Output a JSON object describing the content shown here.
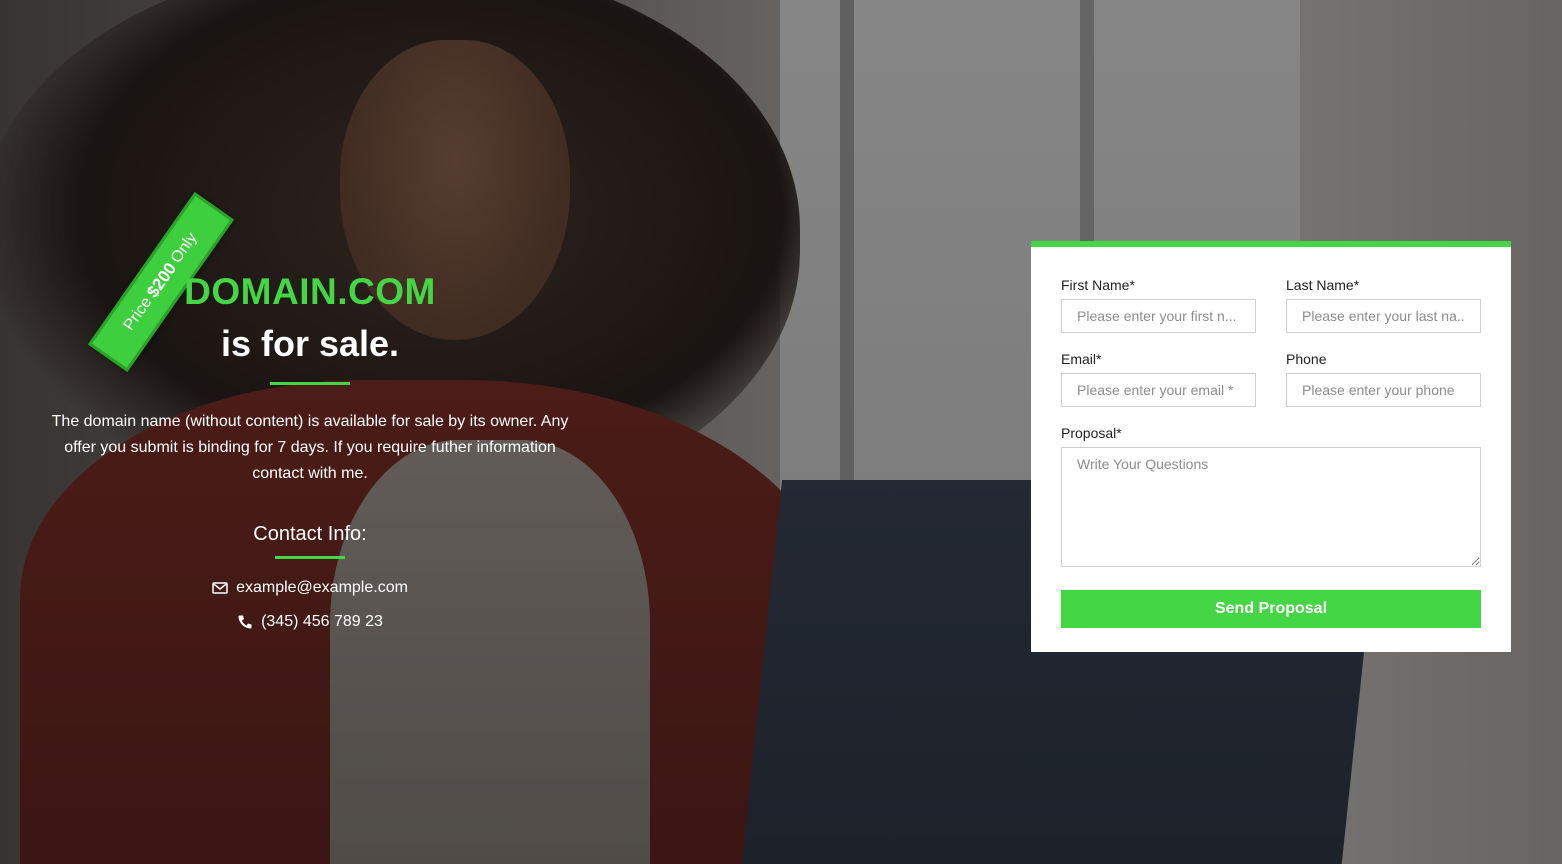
{
  "hero": {
    "domain": "DOMAIN.COM",
    "tagline": "is for sale.",
    "description": "The domain name (without content) is available for sale by its owner. Any offer you submit is binding for 7 days. If you require futher information contact with me.",
    "contact_title": "Contact Info:",
    "email": "example@example.com",
    "phone": "(345) 456 789 23"
  },
  "ribbon": {
    "prefix": "Price",
    "price": "$200",
    "suffix": "Only"
  },
  "form": {
    "first_name_label": "First Name*",
    "first_name_placeholder": "Please enter your first n...",
    "last_name_label": "Last Name*",
    "last_name_placeholder": "Please enter your last na...",
    "email_label": "Email*",
    "email_placeholder": "Please enter your email *",
    "phone_label": "Phone",
    "phone_placeholder": "Please enter your phone",
    "proposal_label": "Proposal*",
    "proposal_placeholder": "Write Your Questions",
    "submit_label": "Send Proposal"
  },
  "icons": {
    "email": "envelope-icon",
    "phone": "phone-icon"
  },
  "colors": {
    "accent": "#45d645"
  }
}
